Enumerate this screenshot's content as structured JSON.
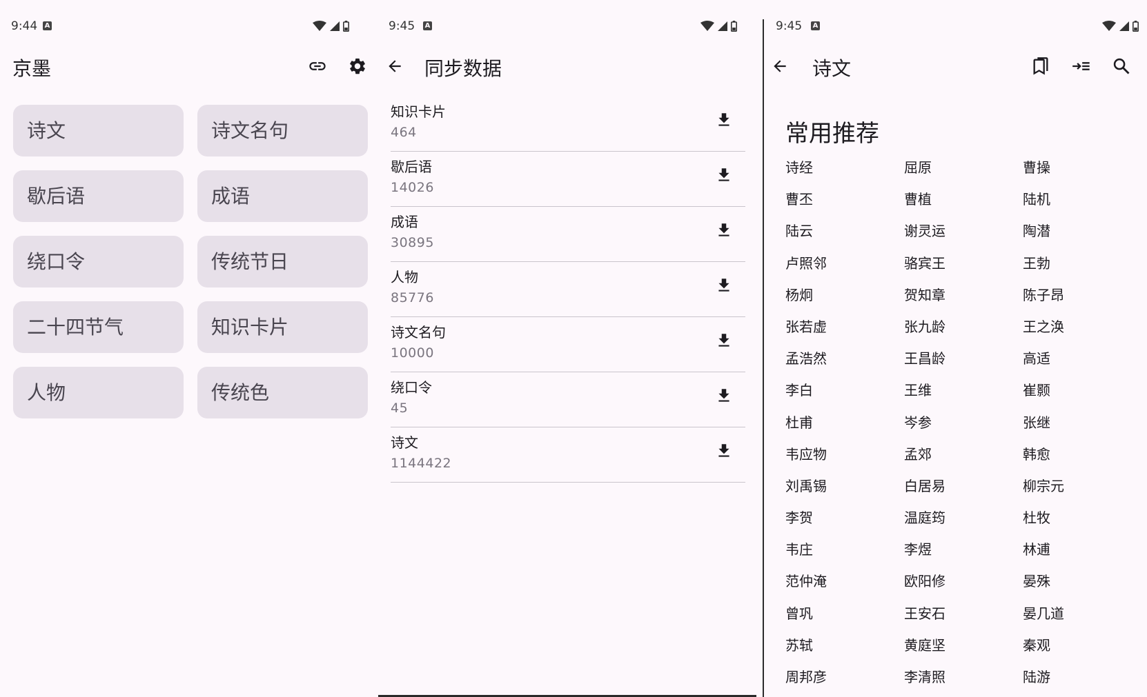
{
  "screen1": {
    "status": {
      "time": "9:44"
    },
    "title": "京墨",
    "tiles": [
      "诗文",
      "诗文名句",
      "歇后语",
      "成语",
      "绕口令",
      "传统节日",
      "二十四节气",
      "知识卡片",
      "人物",
      "传统色"
    ],
    "icons": {
      "link": "link-icon",
      "settings": "gear-icon"
    }
  },
  "screen2": {
    "status": {
      "time": "9:45"
    },
    "title": "同步数据",
    "items": [
      {
        "name": "知识卡片",
        "count": "464"
      },
      {
        "name": "歇后语",
        "count": "14026"
      },
      {
        "name": "成语",
        "count": "30895"
      },
      {
        "name": "人物",
        "count": "85776"
      },
      {
        "name": "诗文名句",
        "count": "10000"
      },
      {
        "name": "绕口令",
        "count": "45"
      },
      {
        "name": "诗文",
        "count": "1144422"
      }
    ],
    "icons": {
      "back": "arrow-left-icon",
      "download": "download-icon"
    }
  },
  "screen3": {
    "status": {
      "time": "9:45"
    },
    "title": "诗文",
    "section_title": "常用推荐",
    "poets": [
      "诗经",
      "屈原",
      "曹操",
      "曹丕",
      "曹植",
      "陆机",
      "陆云",
      "谢灵运",
      "陶潜",
      "卢照邻",
      "骆宾王",
      "王勃",
      "杨炯",
      "贺知章",
      "陈子昂",
      "张若虚",
      "张九龄",
      "王之涣",
      "孟浩然",
      "王昌龄",
      "高适",
      "李白",
      "王维",
      "崔颢",
      "杜甫",
      "岑参",
      "张继",
      "韦应物",
      "孟郊",
      "韩愈",
      "刘禹锡",
      "白居易",
      "柳宗元",
      "李贺",
      "温庭筠",
      "杜牧",
      "韦庄",
      "李煜",
      "林逋",
      "范仲淹",
      "欧阳修",
      "晏殊",
      "曾巩",
      "王安石",
      "晏几道",
      "苏轼",
      "黄庭坚",
      "秦观",
      "周邦彦",
      "李清照",
      "陆游"
    ],
    "icons": {
      "back": "arrow-left-icon",
      "bookmark": "bookmark-icon",
      "indent": "indent-icon",
      "search": "search-icon"
    }
  },
  "colors": {
    "background": "#fdf8fc",
    "tile": "#e7e0e9",
    "tile_text": "#49454f",
    "secondary_text": "#7a757f",
    "divider": "#c9c4cc"
  }
}
